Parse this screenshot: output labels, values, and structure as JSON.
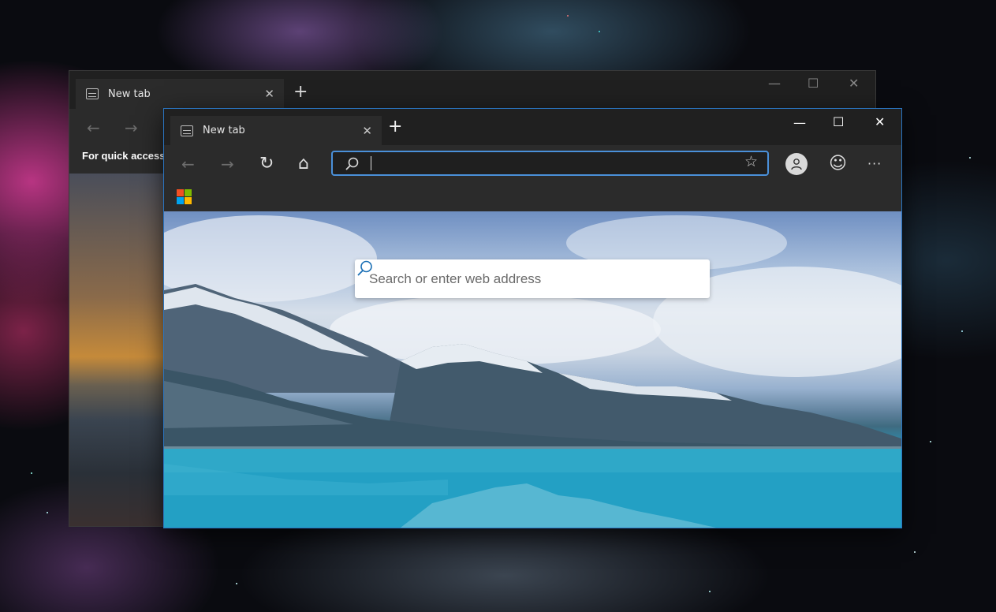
{
  "back_window": {
    "tab": {
      "title": "New tab",
      "close": "✕"
    },
    "new_tab": "+",
    "controls": {
      "minimize": "—",
      "maximize": "☐",
      "close": "✕"
    },
    "nav": {
      "back": "←",
      "forward": "→"
    },
    "quick_access_text": "For quick access,"
  },
  "front_window": {
    "tab": {
      "title": "New tab",
      "close": "✕"
    },
    "new_tab": "+",
    "controls": {
      "minimize": "—",
      "maximize": "☐",
      "close": "✕"
    },
    "toolbar": {
      "back": "←",
      "forward": "→",
      "refresh": "↻",
      "home": "⌂",
      "favorite": "☆",
      "feedback": "☺",
      "more": "···"
    },
    "new_tab_page": {
      "search_placeholder": "Search or enter web address"
    }
  },
  "colors": {
    "accent": "#4a90d9",
    "titlebar": "#202020",
    "toolbar": "#2b2b2b"
  }
}
